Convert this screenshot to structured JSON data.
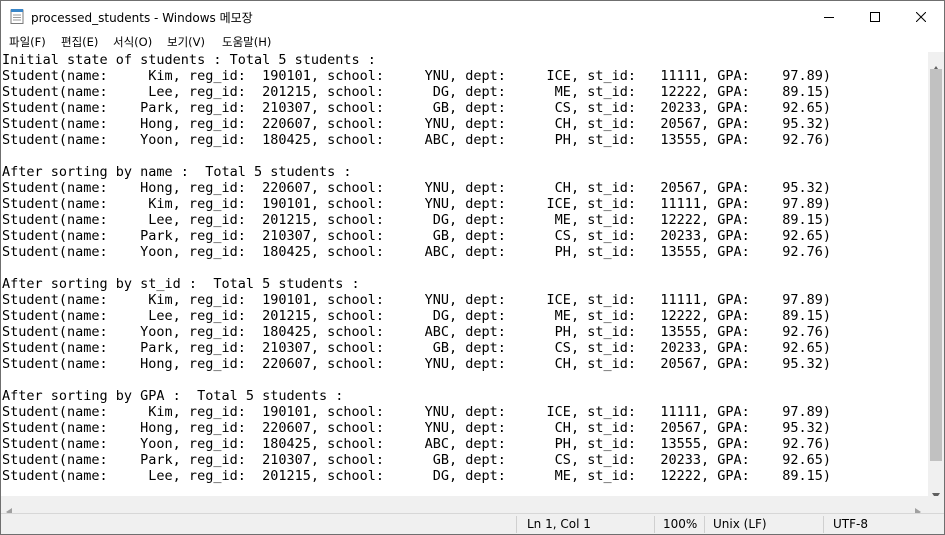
{
  "window": {
    "title": "processed_students - Windows 메모장"
  },
  "icons": {
    "app": "notepad-icon",
    "minimize": "minimize-icon",
    "maximize": "maximize-icon",
    "close": "close-icon",
    "scroll_up": "arrow-up-icon",
    "scroll_down": "arrow-down-icon",
    "scroll_left": "arrow-left-icon",
    "scroll_right": "arrow-right-icon"
  },
  "menu": {
    "file": "파일(F)",
    "edit": "편집(E)",
    "format": "서식(O)",
    "view": "보기(V)",
    "help": "도움말(H)"
  },
  "editor": {
    "content": "Initial state of students : Total 5 students :\nStudent(name:     Kim, reg_id:  190101, school:     YNU, dept:     ICE, st_id:   11111, GPA:    97.89)\nStudent(name:     Lee, reg_id:  201215, school:      DG, dept:      ME, st_id:   12222, GPA:    89.15)\nStudent(name:    Park, reg_id:  210307, school:      GB, dept:      CS, st_id:   20233, GPA:    92.65)\nStudent(name:    Hong, reg_id:  220607, school:     YNU, dept:      CH, st_id:   20567, GPA:    95.32)\nStudent(name:    Yoon, reg_id:  180425, school:     ABC, dept:      PH, st_id:   13555, GPA:    92.76)\n\nAfter sorting by name :  Total 5 students :\nStudent(name:    Hong, reg_id:  220607, school:     YNU, dept:      CH, st_id:   20567, GPA:    95.32)\nStudent(name:     Kim, reg_id:  190101, school:     YNU, dept:     ICE, st_id:   11111, GPA:    97.89)\nStudent(name:     Lee, reg_id:  201215, school:      DG, dept:      ME, st_id:   12222, GPA:    89.15)\nStudent(name:    Park, reg_id:  210307, school:      GB, dept:      CS, st_id:   20233, GPA:    92.65)\nStudent(name:    Yoon, reg_id:  180425, school:     ABC, dept:      PH, st_id:   13555, GPA:    92.76)\n\nAfter sorting by st_id :  Total 5 students :\nStudent(name:     Kim, reg_id:  190101, school:     YNU, dept:     ICE, st_id:   11111, GPA:    97.89)\nStudent(name:     Lee, reg_id:  201215, school:      DG, dept:      ME, st_id:   12222, GPA:    89.15)\nStudent(name:    Yoon, reg_id:  180425, school:     ABC, dept:      PH, st_id:   13555, GPA:    92.76)\nStudent(name:    Park, reg_id:  210307, school:      GB, dept:      CS, st_id:   20233, GPA:    92.65)\nStudent(name:    Hong, reg_id:  220607, school:     YNU, dept:      CH, st_id:   20567, GPA:    95.32)\n\nAfter sorting by GPA :  Total 5 students :\nStudent(name:     Kim, reg_id:  190101, school:     YNU, dept:     ICE, st_id:   11111, GPA:    97.89)\nStudent(name:    Hong, reg_id:  220607, school:     YNU, dept:      CH, st_id:   20567, GPA:    95.32)\nStudent(name:    Yoon, reg_id:  180425, school:     ABC, dept:      PH, st_id:   13555, GPA:    92.76)\nStudent(name:    Park, reg_id:  210307, school:      GB, dept:      CS, st_id:   20233, GPA:    92.65)\nStudent(name:     Lee, reg_id:  201215, school:      DG, dept:      ME, st_id:   12222, GPA:    89.15)"
  },
  "status": {
    "position": "Ln 1, Col 1",
    "zoom": "100%",
    "line_ending": "Unix (LF)",
    "encoding": "UTF-8"
  }
}
